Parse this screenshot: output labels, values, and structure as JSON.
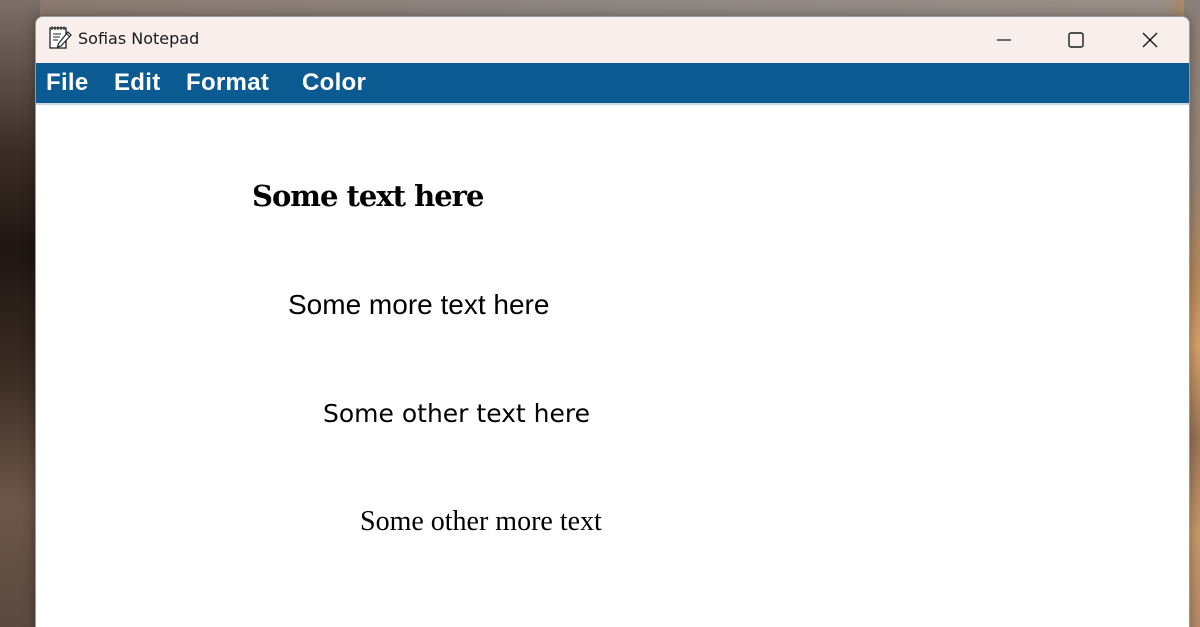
{
  "window": {
    "title": "Sofias Notepad",
    "controls": {
      "minimize": "minimize-icon",
      "maximize": "maximize-icon",
      "close": "close-icon"
    }
  },
  "menu": {
    "items": [
      {
        "label": "File"
      },
      {
        "label": "Edit"
      },
      {
        "label": "Format"
      },
      {
        "label": "Color"
      }
    ],
    "background_color": "#0b5a92",
    "text_color": "#ffffff"
  },
  "document": {
    "lines": [
      "Some text here",
      "Some more text here",
      "Some other text here",
      "Some other more text"
    ]
  },
  "icons": {
    "app": "notepad-icon"
  }
}
